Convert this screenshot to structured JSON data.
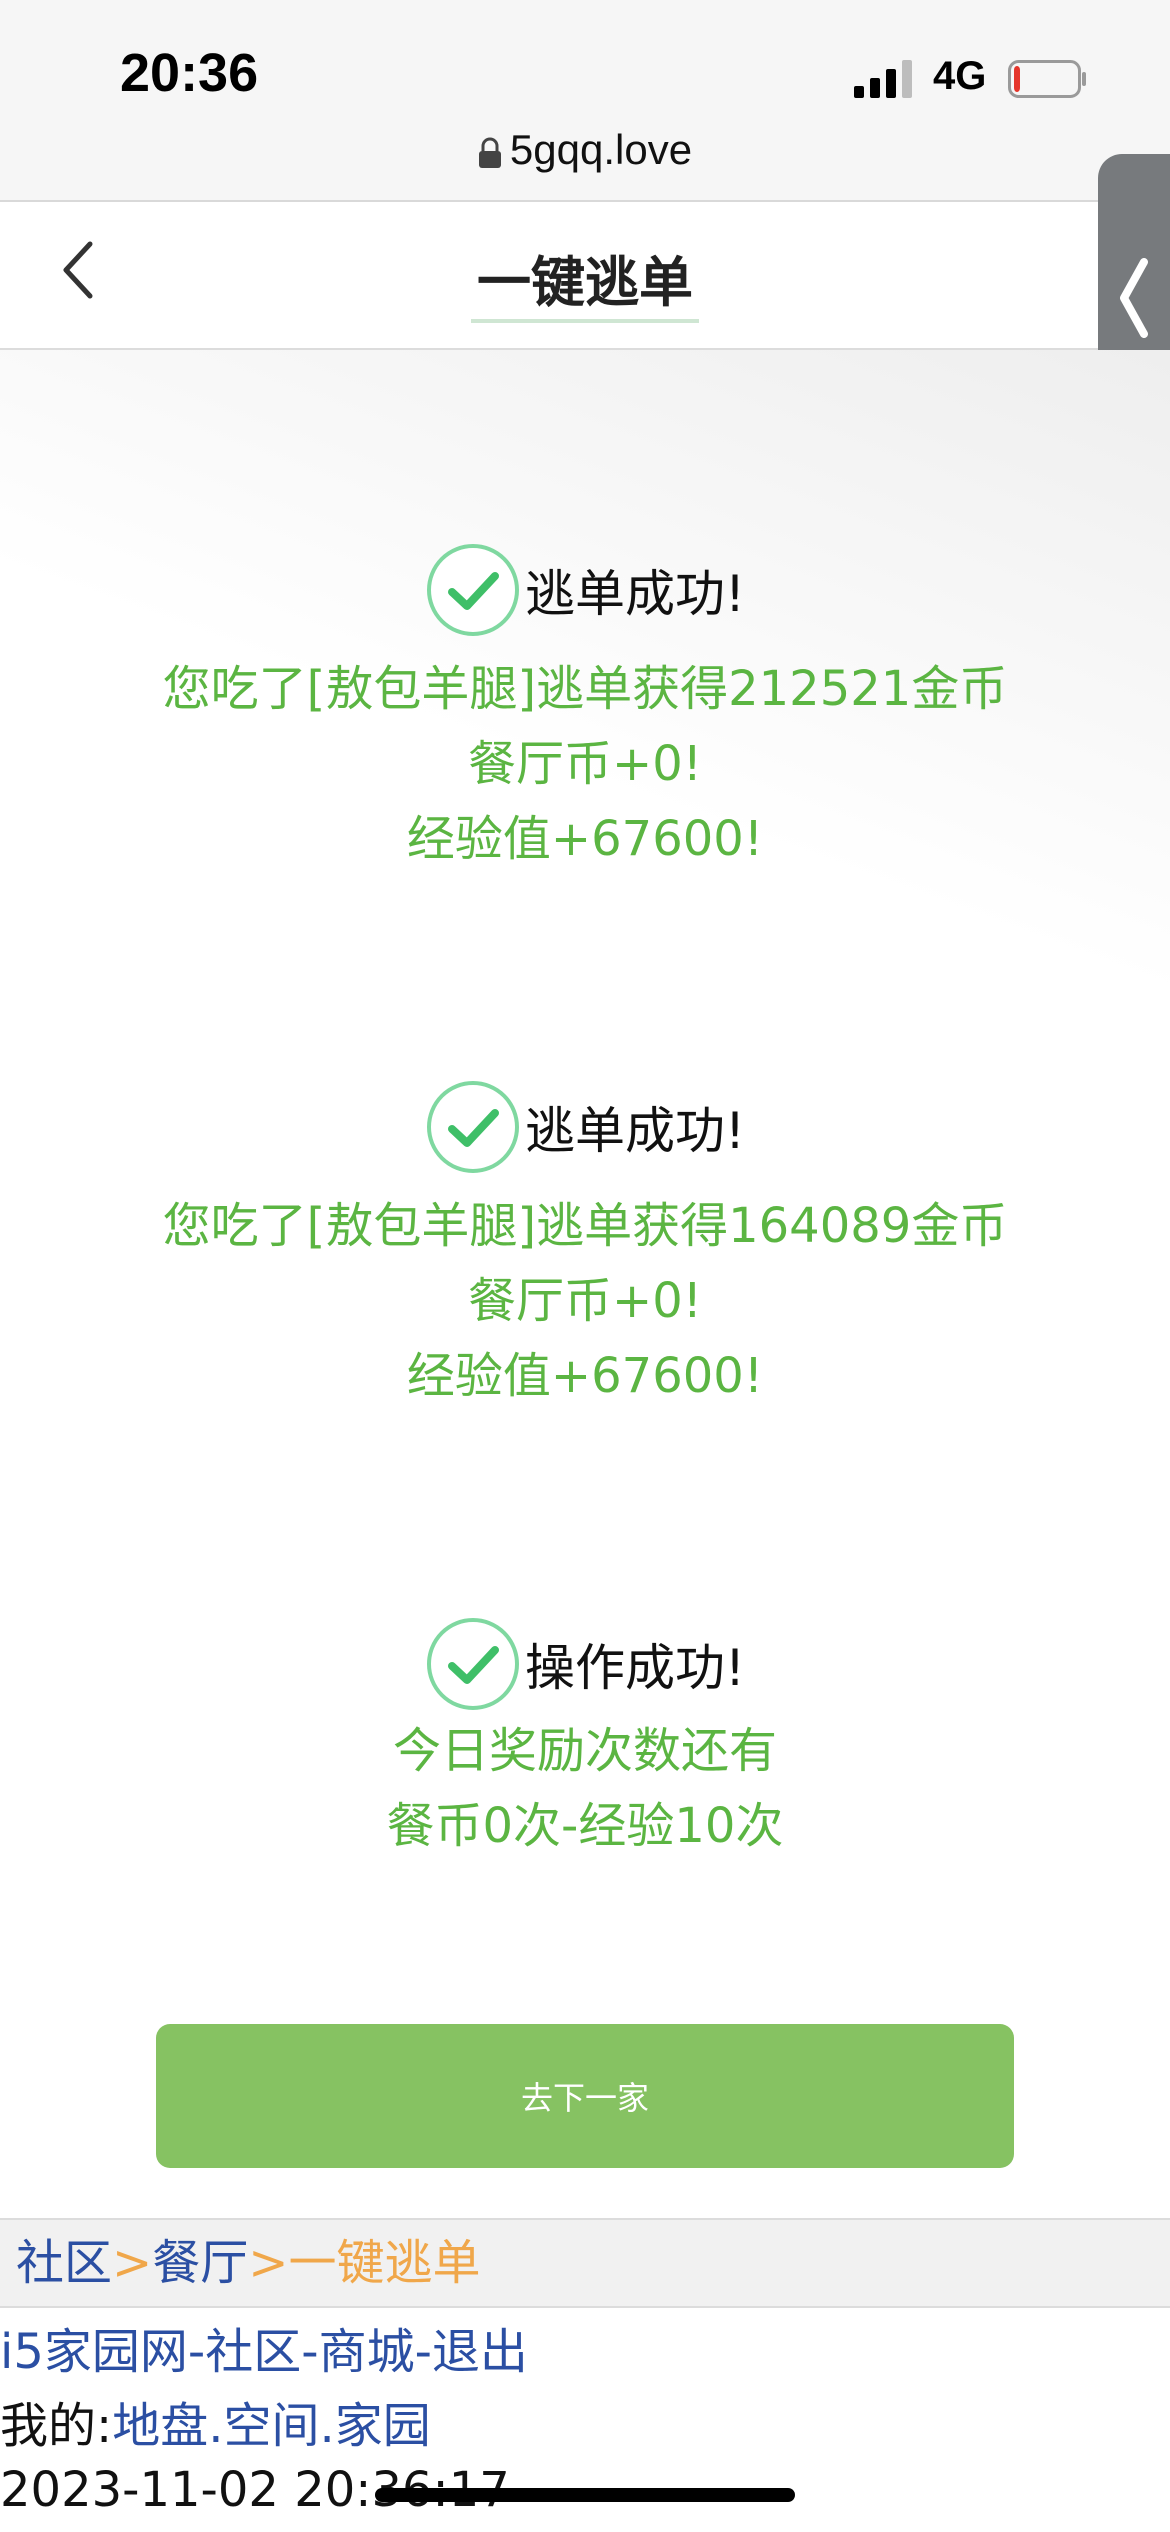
{
  "status_bar": {
    "time": "20:36",
    "network": "4G",
    "url": "5gqq.love",
    "battery_level": 0.1,
    "battery_color": "#e5352b"
  },
  "nav": {
    "title": "一键逃单",
    "back_icon": "chevron-left-icon",
    "side_handle_icon": "chevron-left-icon"
  },
  "messages": [
    {
      "icon": "check-circle-icon",
      "heading": "逃单成功!",
      "lines": [
        "您吃了[敖包羊腿]逃单获得212521金币",
        "餐厅币+0!",
        "经验值+67600!"
      ]
    },
    {
      "icon": "check-circle-icon",
      "heading": "逃单成功!",
      "lines": [
        "您吃了[敖包羊腿]逃单获得164089金币",
        "餐厅币+0!",
        "经验值+67600!"
      ]
    },
    {
      "icon": "check-circle-icon",
      "heading": "操作成功!",
      "lines": [
        "今日奖励次数还有",
        "餐币0次-经验10次"
      ]
    }
  ],
  "next_button": {
    "label": "去下一家",
    "color": "#86c262"
  },
  "breadcrumb": {
    "items": [
      "社区",
      "餐厅"
    ],
    "separator": ">",
    "current": "一键逃单"
  },
  "footer": {
    "links": [
      "i5家园网",
      "社区",
      "商城",
      "退出"
    ],
    "link_separator": "-",
    "mine_label": "我的:",
    "mine_links": [
      "地盘",
      "空间",
      "家园"
    ],
    "mine_separator": ".",
    "datetime": "2023-11-02 20:36:17"
  },
  "colors": {
    "success_text": "#5bb542",
    "check_ring": "#7fd8a0",
    "check_mark": "#3fbf68",
    "link": "#2b4fa3",
    "breadcrumb_current": "#f0a74a"
  }
}
